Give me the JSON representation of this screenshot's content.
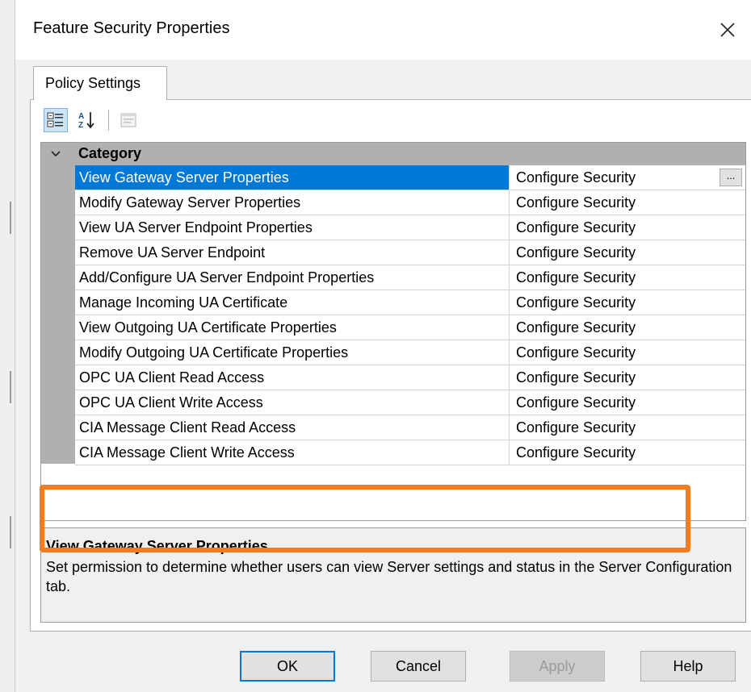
{
  "window": {
    "title": "Feature Security Properties"
  },
  "tabs": [
    {
      "label": "Policy Settings"
    }
  ],
  "grid": {
    "category": "Category",
    "rows": [
      {
        "name": "View Gateway Server Properties",
        "value": "Configure Security",
        "ellipsis": "..."
      },
      {
        "name": "Modify Gateway Server Properties",
        "value": "Configure Security"
      },
      {
        "name": "View UA Server Endpoint Properties",
        "value": "Configure Security"
      },
      {
        "name": "Remove UA Server Endpoint",
        "value": "Configure Security"
      },
      {
        "name": "Add/Configure UA Server Endpoint Properties",
        "value": "Configure Security"
      },
      {
        "name": "Manage Incoming UA Certificate",
        "value": "Configure Security"
      },
      {
        "name": "View Outgoing UA Certificate Properties",
        "value": "Configure Security"
      },
      {
        "name": "Modify Outgoing UA Certificate Properties",
        "value": "Configure Security"
      },
      {
        "name": "OPC UA Client Read Access",
        "value": "Configure Security"
      },
      {
        "name": "OPC UA Client Write Access",
        "value": "Configure Security"
      },
      {
        "name": "CIA Message Client Read Access",
        "value": "Configure Security"
      },
      {
        "name": "CIA Message Client Write Access",
        "value": "Configure Security"
      }
    ]
  },
  "description": {
    "title": "View Gateway Server Properties",
    "text": "Set permission to determine whether users can view Server settings and status in the Server Configuration tab."
  },
  "buttons": {
    "ok": "OK",
    "cancel": "Cancel",
    "apply": "Apply",
    "help": "Help"
  },
  "colors": {
    "selection": "#0078d7",
    "highlight": "#f07d22",
    "category": "#b0b0b0"
  },
  "icons": {
    "close": "close-icon",
    "categorized": "categorized-icon",
    "alphabetical": "sort-alphabetical-icon",
    "property_pages": "property-pages-icon",
    "collapse": "chevron-down-icon"
  }
}
